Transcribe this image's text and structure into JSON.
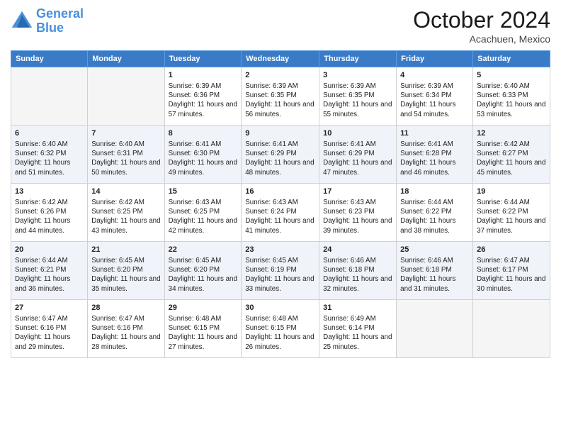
{
  "header": {
    "logo_line1": "General",
    "logo_line2": "Blue",
    "month": "October 2024",
    "location": "Acachuen, Mexico"
  },
  "days_of_week": [
    "Sunday",
    "Monday",
    "Tuesday",
    "Wednesday",
    "Thursday",
    "Friday",
    "Saturday"
  ],
  "weeks": [
    [
      {
        "num": "",
        "info": ""
      },
      {
        "num": "",
        "info": ""
      },
      {
        "num": "1",
        "info": "Sunrise: 6:39 AM\nSunset: 6:36 PM\nDaylight: 11 hours and 57 minutes."
      },
      {
        "num": "2",
        "info": "Sunrise: 6:39 AM\nSunset: 6:35 PM\nDaylight: 11 hours and 56 minutes."
      },
      {
        "num": "3",
        "info": "Sunrise: 6:39 AM\nSunset: 6:35 PM\nDaylight: 11 hours and 55 minutes."
      },
      {
        "num": "4",
        "info": "Sunrise: 6:39 AM\nSunset: 6:34 PM\nDaylight: 11 hours and 54 minutes."
      },
      {
        "num": "5",
        "info": "Sunrise: 6:40 AM\nSunset: 6:33 PM\nDaylight: 11 hours and 53 minutes."
      }
    ],
    [
      {
        "num": "6",
        "info": "Sunrise: 6:40 AM\nSunset: 6:32 PM\nDaylight: 11 hours and 51 minutes."
      },
      {
        "num": "7",
        "info": "Sunrise: 6:40 AM\nSunset: 6:31 PM\nDaylight: 11 hours and 50 minutes."
      },
      {
        "num": "8",
        "info": "Sunrise: 6:41 AM\nSunset: 6:30 PM\nDaylight: 11 hours and 49 minutes."
      },
      {
        "num": "9",
        "info": "Sunrise: 6:41 AM\nSunset: 6:29 PM\nDaylight: 11 hours and 48 minutes."
      },
      {
        "num": "10",
        "info": "Sunrise: 6:41 AM\nSunset: 6:29 PM\nDaylight: 11 hours and 47 minutes."
      },
      {
        "num": "11",
        "info": "Sunrise: 6:41 AM\nSunset: 6:28 PM\nDaylight: 11 hours and 46 minutes."
      },
      {
        "num": "12",
        "info": "Sunrise: 6:42 AM\nSunset: 6:27 PM\nDaylight: 11 hours and 45 minutes."
      }
    ],
    [
      {
        "num": "13",
        "info": "Sunrise: 6:42 AM\nSunset: 6:26 PM\nDaylight: 11 hours and 44 minutes."
      },
      {
        "num": "14",
        "info": "Sunrise: 6:42 AM\nSunset: 6:25 PM\nDaylight: 11 hours and 43 minutes."
      },
      {
        "num": "15",
        "info": "Sunrise: 6:43 AM\nSunset: 6:25 PM\nDaylight: 11 hours and 42 minutes."
      },
      {
        "num": "16",
        "info": "Sunrise: 6:43 AM\nSunset: 6:24 PM\nDaylight: 11 hours and 41 minutes."
      },
      {
        "num": "17",
        "info": "Sunrise: 6:43 AM\nSunset: 6:23 PM\nDaylight: 11 hours and 39 minutes."
      },
      {
        "num": "18",
        "info": "Sunrise: 6:44 AM\nSunset: 6:22 PM\nDaylight: 11 hours and 38 minutes."
      },
      {
        "num": "19",
        "info": "Sunrise: 6:44 AM\nSunset: 6:22 PM\nDaylight: 11 hours and 37 minutes."
      }
    ],
    [
      {
        "num": "20",
        "info": "Sunrise: 6:44 AM\nSunset: 6:21 PM\nDaylight: 11 hours and 36 minutes."
      },
      {
        "num": "21",
        "info": "Sunrise: 6:45 AM\nSunset: 6:20 PM\nDaylight: 11 hours and 35 minutes."
      },
      {
        "num": "22",
        "info": "Sunrise: 6:45 AM\nSunset: 6:20 PM\nDaylight: 11 hours and 34 minutes."
      },
      {
        "num": "23",
        "info": "Sunrise: 6:45 AM\nSunset: 6:19 PM\nDaylight: 11 hours and 33 minutes."
      },
      {
        "num": "24",
        "info": "Sunrise: 6:46 AM\nSunset: 6:18 PM\nDaylight: 11 hours and 32 minutes."
      },
      {
        "num": "25",
        "info": "Sunrise: 6:46 AM\nSunset: 6:18 PM\nDaylight: 11 hours and 31 minutes."
      },
      {
        "num": "26",
        "info": "Sunrise: 6:47 AM\nSunset: 6:17 PM\nDaylight: 11 hours and 30 minutes."
      }
    ],
    [
      {
        "num": "27",
        "info": "Sunrise: 6:47 AM\nSunset: 6:16 PM\nDaylight: 11 hours and 29 minutes."
      },
      {
        "num": "28",
        "info": "Sunrise: 6:47 AM\nSunset: 6:16 PM\nDaylight: 11 hours and 28 minutes."
      },
      {
        "num": "29",
        "info": "Sunrise: 6:48 AM\nSunset: 6:15 PM\nDaylight: 11 hours and 27 minutes."
      },
      {
        "num": "30",
        "info": "Sunrise: 6:48 AM\nSunset: 6:15 PM\nDaylight: 11 hours and 26 minutes."
      },
      {
        "num": "31",
        "info": "Sunrise: 6:49 AM\nSunset: 6:14 PM\nDaylight: 11 hours and 25 minutes."
      },
      {
        "num": "",
        "info": ""
      },
      {
        "num": "",
        "info": ""
      }
    ]
  ]
}
